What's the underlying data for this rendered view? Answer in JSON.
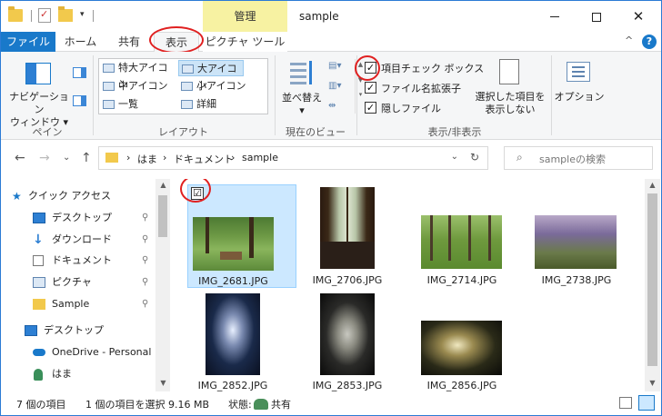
{
  "window": {
    "title": "sample",
    "context_tab": "管理",
    "controls": {
      "minimize": "─",
      "maximize": "☐",
      "close": "✕"
    }
  },
  "quick_access": {
    "dropdown": "▾"
  },
  "ribbon_tabs": [
    "ファイル",
    "ホーム",
    "共有",
    "表示",
    "ピクチャ ツール"
  ],
  "ribbon": {
    "minimize_glyph": "^",
    "help_glyph": "?",
    "panes": {
      "navpane_label_1": "ナビゲーション",
      "navpane_label_2": "ウィンドウ ▾",
      "group": "ペイン"
    },
    "layout": {
      "items": [
        "特大アイコン",
        "大アイコン",
        "中アイコン",
        "小アイコン",
        "一覧",
        "詳細"
      ],
      "selected": "大アイコン",
      "group": "レイアウト",
      "scroll": [
        "▲",
        "▼",
        "▾"
      ]
    },
    "current_view": {
      "sort_label": "並べ替え",
      "sort_caret": "▾",
      "group": "現在のビュー"
    },
    "show_hide": {
      "checkboxes": [
        {
          "label": "項目チェック ボックス",
          "checked": true
        },
        {
          "label": "ファイル名拡張子",
          "checked": true
        },
        {
          "label": "隠しファイル",
          "checked": true
        }
      ],
      "hide_selected_1": "選択した項目を",
      "hide_selected_2": "表示しない",
      "group": "表示/非表示"
    },
    "options_label": "オプション"
  },
  "navigation": {
    "back": "←",
    "forward": "→",
    "recent": "⌄",
    "up": "↑",
    "breadcrumbs": [
      "›",
      "はま",
      "›",
      "ドキュメント",
      "›",
      "sample"
    ],
    "dropdown": "⌄",
    "refresh": "↻",
    "search_placeholder": "sampleの検索",
    "search_icon": "⌕"
  },
  "sidebar": {
    "items": [
      {
        "label": "クイック アクセス",
        "icon": "star-icon",
        "pinned": false
      },
      {
        "label": "デスクトップ",
        "icon": "desktop-icon",
        "pinned": true
      },
      {
        "label": "ダウンロード",
        "icon": "download-icon",
        "pinned": true
      },
      {
        "label": "ドキュメント",
        "icon": "document-icon",
        "pinned": true
      },
      {
        "label": "ピクチャ",
        "icon": "pictures-icon",
        "pinned": true
      },
      {
        "label": "Sample",
        "icon": "folder-icon",
        "pinned": true
      },
      {
        "label": "デスクトップ",
        "icon": "desktop-icon",
        "pinned": false
      },
      {
        "label": "OneDrive - Personal",
        "icon": "cloud-icon",
        "pinned": false
      },
      {
        "label": "はま",
        "icon": "user-icon",
        "pinned": false
      }
    ],
    "pin_glyph": "📌"
  },
  "files": [
    {
      "name": "IMG_2681.JPG",
      "selected": true,
      "checked": true
    },
    {
      "name": "IMG_2706.JPG",
      "selected": false,
      "checked": false
    },
    {
      "name": "IMG_2714.JPG",
      "selected": false,
      "checked": false
    },
    {
      "name": "IMG_2738.JPG",
      "selected": false,
      "checked": false
    },
    {
      "name": "IMG_2852.JPG",
      "selected": false,
      "checked": false
    },
    {
      "name": "IMG_2853.JPG",
      "selected": false,
      "checked": false
    },
    {
      "name": "IMG_2856.JPG",
      "selected": false,
      "checked": false
    }
  ],
  "checkmark": "☑",
  "status": {
    "item_count": "7 個の項目",
    "selection": "1 個の項目を選択  9.16 MB",
    "state_label": "状態:",
    "state_value": "共有"
  },
  "scroll_glyphs": {
    "up": "▲",
    "down": "▼"
  },
  "colors": {
    "accent": "#1979ca",
    "context_tab": "#f7f2a2",
    "selection_bg": "#cce8ff",
    "annotation": "#e02020"
  }
}
